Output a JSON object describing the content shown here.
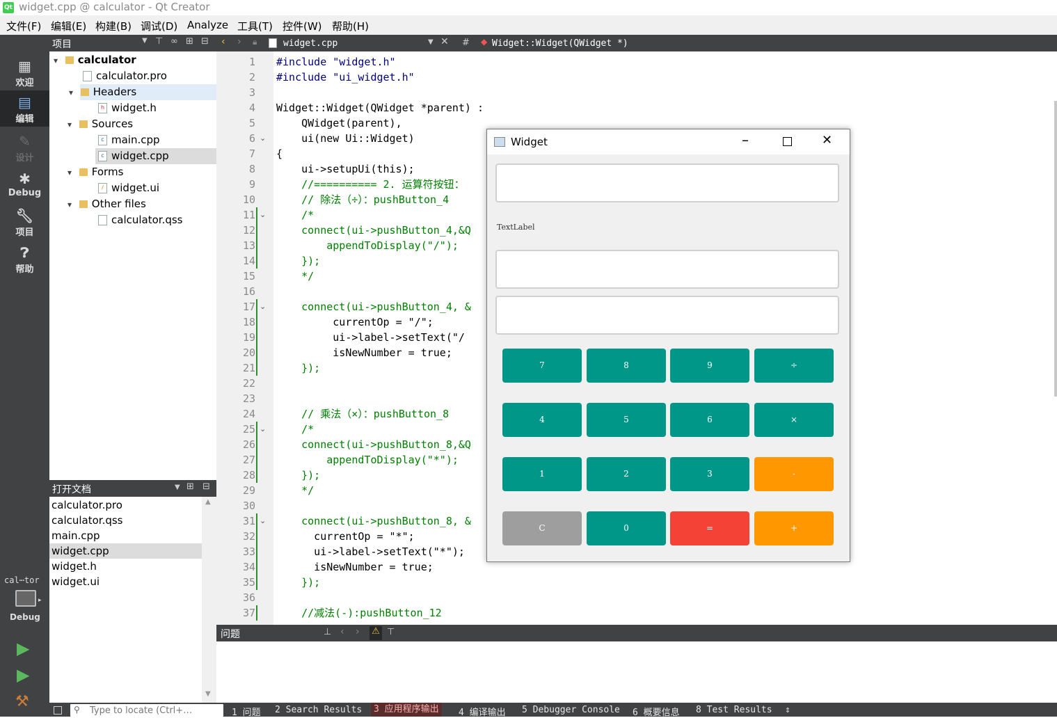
{
  "window": {
    "title": "widget.cpp @ calculator - Qt Creator",
    "logo": "Qt"
  },
  "menu": [
    "文件(F)",
    "编辑(E)",
    "构建(B)",
    "调试(D)",
    "Analyze",
    "工具(T)",
    "控件(W)",
    "帮助(H)"
  ],
  "modes": [
    {
      "label": "欢迎",
      "icon": "grid-icon"
    },
    {
      "label": "编辑",
      "icon": "edit-icon"
    },
    {
      "label": "设计",
      "icon": "pen-icon"
    },
    {
      "label": "Debug",
      "icon": "bug-icon"
    },
    {
      "label": "项目",
      "icon": "wrench-icon"
    },
    {
      "label": "帮助",
      "icon": "help-icon"
    }
  ],
  "kit": {
    "name": "cal⋯tor",
    "mode": "Debug"
  },
  "project_panel": {
    "title": "项目",
    "tree": [
      {
        "label": "calculator",
        "type": "project"
      },
      {
        "label": "calculator.pro",
        "type": "file"
      },
      {
        "label": "Headers",
        "type": "folder"
      },
      {
        "label": "widget.h",
        "type": "file"
      },
      {
        "label": "Sources",
        "type": "folder"
      },
      {
        "label": "main.cpp",
        "type": "file"
      },
      {
        "label": "widget.cpp",
        "type": "file"
      },
      {
        "label": "Forms",
        "type": "folder"
      },
      {
        "label": "widget.ui",
        "type": "file"
      },
      {
        "label": "Other files",
        "type": "folder"
      },
      {
        "label": "calculator.qss",
        "type": "file"
      }
    ]
  },
  "open_docs": {
    "title": "打开文档",
    "items": [
      "calculator.pro",
      "calculator.qss",
      "main.cpp",
      "widget.cpp",
      "widget.h",
      "widget.ui"
    ]
  },
  "editor": {
    "file": "widget.cpp",
    "hash": "#",
    "symbol": "Widget::Widget(QWidget *)",
    "lines": [
      "#include \"widget.h\"",
      "#include \"ui_widget.h\"",
      "",
      "Widget::Widget(QWidget *parent) :",
      "    QWidget(parent),",
      "    ui(new Ui::Widget)",
      "{",
      "    ui->setupUi(this);",
      "    //========== 2. 运算符按钮：",
      "    // 除法（÷）：pushButton_4",
      "    /*",
      "    connect(ui->pushButton_4,&Q",
      "        appendToDisplay(\"/\");",
      "    });",
      "    */",
      "",
      "    connect(ui->pushButton_4, &",
      "         currentOp = \"/\";",
      "         ui->label->setText(\"/",
      "         isNewNumber = true;",
      "    });",
      "",
      "",
      "    // 乘法（×）：pushButton_8",
      "    /*",
      "    connect(ui->pushButton_8,&Q",
      "        appendToDisplay(\"*\");",
      "    });",
      "    */",
      "",
      "    connect(ui->pushButton_8, &",
      "      currentOp = \"*\";",
      "      ui->label->setText(\"*\");",
      "      isNewNumber = true;",
      "    });",
      "",
      "    //减法(-):pushButton_12"
    ]
  },
  "issues": {
    "title": "问题"
  },
  "statusbar": {
    "search_placeholder": "Type to locate (Ctrl+…",
    "tabs": [
      "1 问题",
      "2 Search Results",
      "3 应用程序输出",
      "4 编译输出",
      "5 Debugger Console",
      "6 概要信息",
      "8 Test Results"
    ]
  },
  "calc": {
    "title": "Widget",
    "label": "TextLabel",
    "buttons": [
      {
        "text": "7",
        "color": "#009688"
      },
      {
        "text": "8",
        "color": "#009688"
      },
      {
        "text": "9",
        "color": "#009688"
      },
      {
        "text": "÷",
        "color": "#009688"
      },
      {
        "text": "4",
        "color": "#009688"
      },
      {
        "text": "5",
        "color": "#009688"
      },
      {
        "text": "6",
        "color": "#009688"
      },
      {
        "text": "×",
        "color": "#009688"
      },
      {
        "text": "1",
        "color": "#009688"
      },
      {
        "text": "2",
        "color": "#009688"
      },
      {
        "text": "3",
        "color": "#009688"
      },
      {
        "text": "-",
        "color": "#ff9800"
      },
      {
        "text": "C",
        "color": "#9e9e9e"
      },
      {
        "text": "0",
        "color": "#009688"
      },
      {
        "text": "=",
        "color": "#f44336"
      },
      {
        "text": "+",
        "color": "#ff9800"
      }
    ]
  }
}
